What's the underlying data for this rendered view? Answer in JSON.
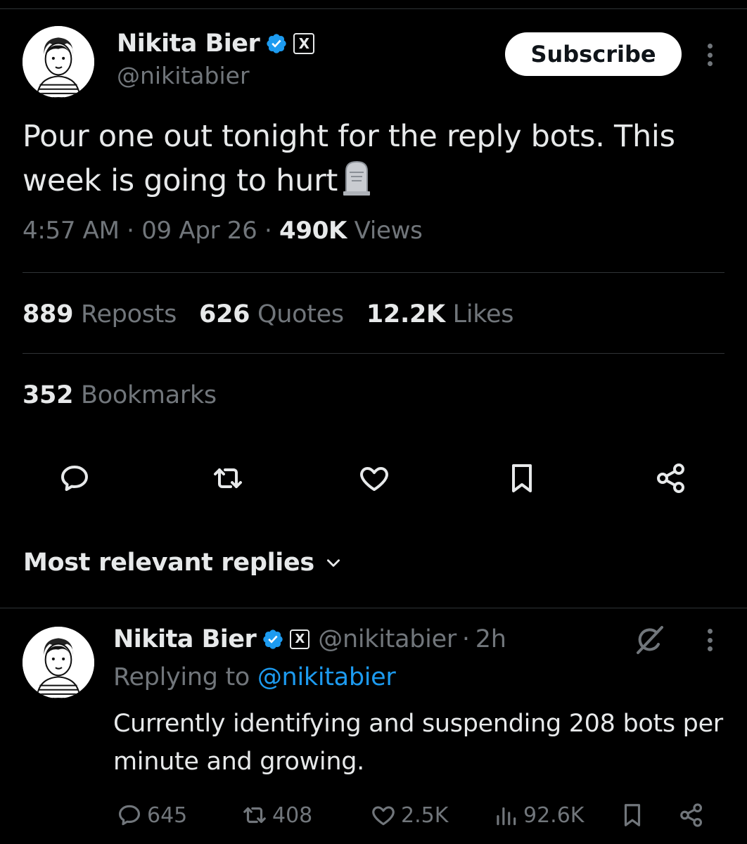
{
  "tweet": {
    "author": {
      "name": "Nikita Bier",
      "handle": "@nikitabier",
      "verified_color": "#1d9bf0",
      "affiliation_badge": "X"
    },
    "subscribe_label": "Subscribe",
    "text": "Pour one out tonight for the reply bots. This week is going to hurt",
    "emoji": "headstone-icon",
    "time": "4:57 AM",
    "date": "09 Apr 26",
    "views_count": "490K",
    "views_label": "Views",
    "reposts_count": "889",
    "reposts_label": "Reposts",
    "quotes_count": "626",
    "quotes_label": "Quotes",
    "likes_count": "12.2K",
    "likes_label": "Likes",
    "bookmarks_count": "352",
    "bookmarks_label": "Bookmarks"
  },
  "actions": [
    "reply-icon",
    "repost-icon",
    "like-icon",
    "bookmark-icon",
    "share-icon"
  ],
  "replies_sort_label": "Most relevant replies",
  "reply": {
    "author_name": "Nikita Bier",
    "author_handle": "@nikitabier",
    "affiliation_badge": "X",
    "age": "2h",
    "replying_prefix": "Replying to",
    "replying_to": "@nikitabier",
    "text": "Currently identifying and suspending 208 bots per minute and growing.",
    "replies": "645",
    "reposts": "408",
    "likes": "2.5K",
    "views": "92.6K"
  },
  "colors": {
    "background": "#000000",
    "text": "#e7e9ea",
    "secondary": "#71767b",
    "accent": "#1d9bf0",
    "divider": "#2f3336"
  }
}
